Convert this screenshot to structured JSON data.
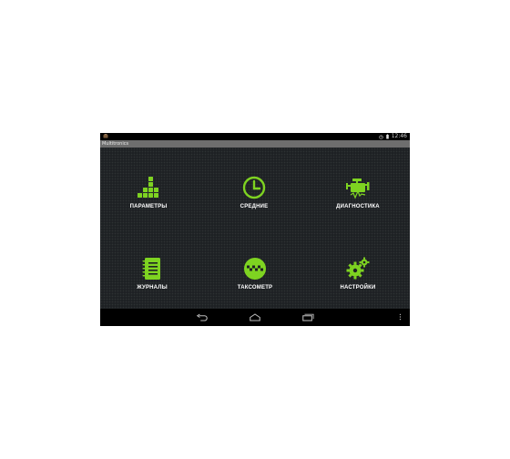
{
  "status_bar": {
    "time": "12:46",
    "icons": [
      "app-notification-icon",
      "alarm-icon",
      "battery-icon"
    ]
  },
  "app": {
    "title": "Multitronics"
  },
  "tiles": [
    {
      "label": "ПАРАМЕТРЫ",
      "icon": "bars-icon"
    },
    {
      "label": "СРЕДНИЕ",
      "icon": "clock-icon"
    },
    {
      "label": "ДИАГНОСТИКА",
      "icon": "engine-icon"
    },
    {
      "label": "ЖУРНАЛЫ",
      "icon": "notebook-icon"
    },
    {
      "label": "ТАКСОМЕТР",
      "icon": "taxi-icon"
    },
    {
      "label": "НАСТРОЙКИ",
      "icon": "gears-icon"
    }
  ],
  "navigation": {
    "buttons": [
      "back-icon",
      "home-icon",
      "recent-apps-icon",
      "overflow-menu-icon"
    ]
  },
  "colors": {
    "accent": "#7ed321",
    "background": "#1e2124",
    "titlebar": "#6e6e6e"
  }
}
